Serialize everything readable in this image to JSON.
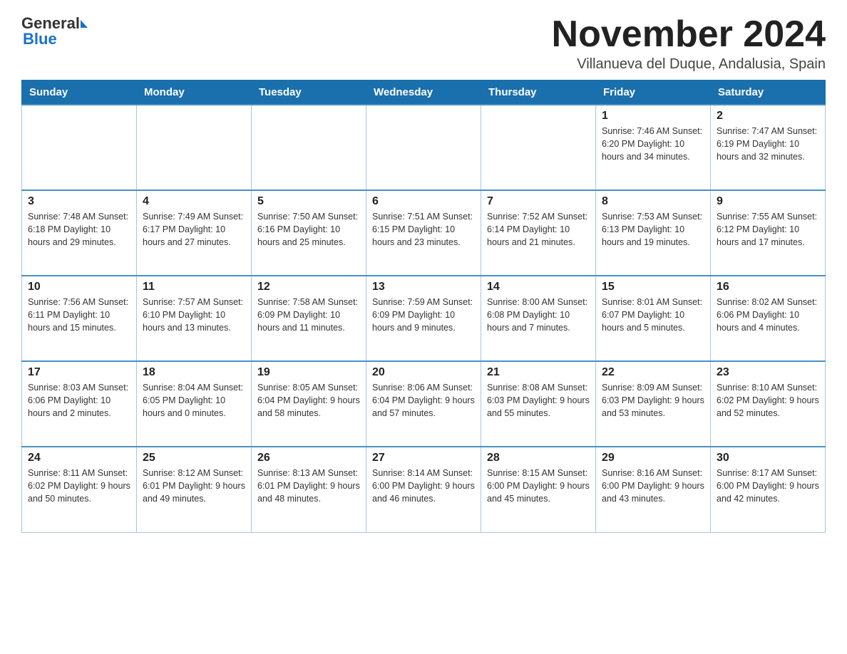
{
  "header": {
    "logo_general": "General",
    "logo_blue": "Blue",
    "month_title": "November 2024",
    "location": "Villanueva del Duque, Andalusia, Spain"
  },
  "days_of_week": [
    "Sunday",
    "Monday",
    "Tuesday",
    "Wednesday",
    "Thursday",
    "Friday",
    "Saturday"
  ],
  "weeks": [
    {
      "days": [
        {
          "number": "",
          "info": ""
        },
        {
          "number": "",
          "info": ""
        },
        {
          "number": "",
          "info": ""
        },
        {
          "number": "",
          "info": ""
        },
        {
          "number": "",
          "info": ""
        },
        {
          "number": "1",
          "info": "Sunrise: 7:46 AM\nSunset: 6:20 PM\nDaylight: 10 hours and 34 minutes."
        },
        {
          "number": "2",
          "info": "Sunrise: 7:47 AM\nSunset: 6:19 PM\nDaylight: 10 hours and 32 minutes."
        }
      ]
    },
    {
      "days": [
        {
          "number": "3",
          "info": "Sunrise: 7:48 AM\nSunset: 6:18 PM\nDaylight: 10 hours and 29 minutes."
        },
        {
          "number": "4",
          "info": "Sunrise: 7:49 AM\nSunset: 6:17 PM\nDaylight: 10 hours and 27 minutes."
        },
        {
          "number": "5",
          "info": "Sunrise: 7:50 AM\nSunset: 6:16 PM\nDaylight: 10 hours and 25 minutes."
        },
        {
          "number": "6",
          "info": "Sunrise: 7:51 AM\nSunset: 6:15 PM\nDaylight: 10 hours and 23 minutes."
        },
        {
          "number": "7",
          "info": "Sunrise: 7:52 AM\nSunset: 6:14 PM\nDaylight: 10 hours and 21 minutes."
        },
        {
          "number": "8",
          "info": "Sunrise: 7:53 AM\nSunset: 6:13 PM\nDaylight: 10 hours and 19 minutes."
        },
        {
          "number": "9",
          "info": "Sunrise: 7:55 AM\nSunset: 6:12 PM\nDaylight: 10 hours and 17 minutes."
        }
      ]
    },
    {
      "days": [
        {
          "number": "10",
          "info": "Sunrise: 7:56 AM\nSunset: 6:11 PM\nDaylight: 10 hours and 15 minutes."
        },
        {
          "number": "11",
          "info": "Sunrise: 7:57 AM\nSunset: 6:10 PM\nDaylight: 10 hours and 13 minutes."
        },
        {
          "number": "12",
          "info": "Sunrise: 7:58 AM\nSunset: 6:09 PM\nDaylight: 10 hours and 11 minutes."
        },
        {
          "number": "13",
          "info": "Sunrise: 7:59 AM\nSunset: 6:09 PM\nDaylight: 10 hours and 9 minutes."
        },
        {
          "number": "14",
          "info": "Sunrise: 8:00 AM\nSunset: 6:08 PM\nDaylight: 10 hours and 7 minutes."
        },
        {
          "number": "15",
          "info": "Sunrise: 8:01 AM\nSunset: 6:07 PM\nDaylight: 10 hours and 5 minutes."
        },
        {
          "number": "16",
          "info": "Sunrise: 8:02 AM\nSunset: 6:06 PM\nDaylight: 10 hours and 4 minutes."
        }
      ]
    },
    {
      "days": [
        {
          "number": "17",
          "info": "Sunrise: 8:03 AM\nSunset: 6:06 PM\nDaylight: 10 hours and 2 minutes."
        },
        {
          "number": "18",
          "info": "Sunrise: 8:04 AM\nSunset: 6:05 PM\nDaylight: 10 hours and 0 minutes."
        },
        {
          "number": "19",
          "info": "Sunrise: 8:05 AM\nSunset: 6:04 PM\nDaylight: 9 hours and 58 minutes."
        },
        {
          "number": "20",
          "info": "Sunrise: 8:06 AM\nSunset: 6:04 PM\nDaylight: 9 hours and 57 minutes."
        },
        {
          "number": "21",
          "info": "Sunrise: 8:08 AM\nSunset: 6:03 PM\nDaylight: 9 hours and 55 minutes."
        },
        {
          "number": "22",
          "info": "Sunrise: 8:09 AM\nSunset: 6:03 PM\nDaylight: 9 hours and 53 minutes."
        },
        {
          "number": "23",
          "info": "Sunrise: 8:10 AM\nSunset: 6:02 PM\nDaylight: 9 hours and 52 minutes."
        }
      ]
    },
    {
      "days": [
        {
          "number": "24",
          "info": "Sunrise: 8:11 AM\nSunset: 6:02 PM\nDaylight: 9 hours and 50 minutes."
        },
        {
          "number": "25",
          "info": "Sunrise: 8:12 AM\nSunset: 6:01 PM\nDaylight: 9 hours and 49 minutes."
        },
        {
          "number": "26",
          "info": "Sunrise: 8:13 AM\nSunset: 6:01 PM\nDaylight: 9 hours and 48 minutes."
        },
        {
          "number": "27",
          "info": "Sunrise: 8:14 AM\nSunset: 6:00 PM\nDaylight: 9 hours and 46 minutes."
        },
        {
          "number": "28",
          "info": "Sunrise: 8:15 AM\nSunset: 6:00 PM\nDaylight: 9 hours and 45 minutes."
        },
        {
          "number": "29",
          "info": "Sunrise: 8:16 AM\nSunset: 6:00 PM\nDaylight: 9 hours and 43 minutes."
        },
        {
          "number": "30",
          "info": "Sunrise: 8:17 AM\nSunset: 6:00 PM\nDaylight: 9 hours and 42 minutes."
        }
      ]
    }
  ]
}
